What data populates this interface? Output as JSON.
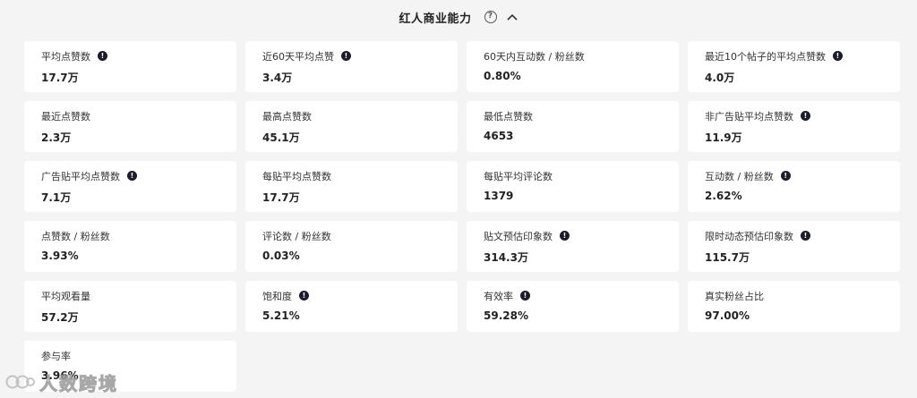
{
  "header": {
    "title": "红人商业能力",
    "help_symbol": "?"
  },
  "icons": {
    "info": "info-icon",
    "help": "help-icon",
    "collapse": "chevron-up-icon"
  },
  "metrics": [
    {
      "label": "平均点赞数",
      "value": "17.7万",
      "info": true
    },
    {
      "label": "近60天平均点赞",
      "value": "3.4万",
      "info": true
    },
    {
      "label": "60天内互动数 / 粉丝数",
      "value": "0.80%",
      "info": false
    },
    {
      "label": "最近10个帖子的平均点赞数",
      "value": "4.0万",
      "info": true
    },
    {
      "label": "最近点赞数",
      "value": "2.3万",
      "info": false
    },
    {
      "label": "最高点赞数",
      "value": "45.1万",
      "info": false
    },
    {
      "label": "最低点赞数",
      "value": "4653",
      "info": false
    },
    {
      "label": "非广告贴平均点赞数",
      "value": "11.9万",
      "info": true
    },
    {
      "label": "广告贴平均点赞数",
      "value": "7.1万",
      "info": true
    },
    {
      "label": "每贴平均点赞数",
      "value": "17.7万",
      "info": false
    },
    {
      "label": "每贴平均评论数",
      "value": "1379",
      "info": false
    },
    {
      "label": "互动数 / 粉丝数",
      "value": "2.62%",
      "info": true
    },
    {
      "label": "点赞数 / 粉丝数",
      "value": "3.93%",
      "info": false
    },
    {
      "label": "评论数 / 粉丝数",
      "value": "0.03%",
      "info": false
    },
    {
      "label": "贴文预估印象数",
      "value": "314.3万",
      "info": true
    },
    {
      "label": "限时动态预估印象数",
      "value": "115.7万",
      "info": true
    },
    {
      "label": "平均观看量",
      "value": "57.2万",
      "info": false
    },
    {
      "label": "饱和度",
      "value": "5.21%",
      "info": true
    },
    {
      "label": "有效率",
      "value": "59.28%",
      "info": true
    },
    {
      "label": "真实粉丝占比",
      "value": "97.00%",
      "info": false
    },
    {
      "label": "参与率",
      "value": "3.96%",
      "info": false
    }
  ],
  "watermark": {
    "text": "人数跨境"
  }
}
